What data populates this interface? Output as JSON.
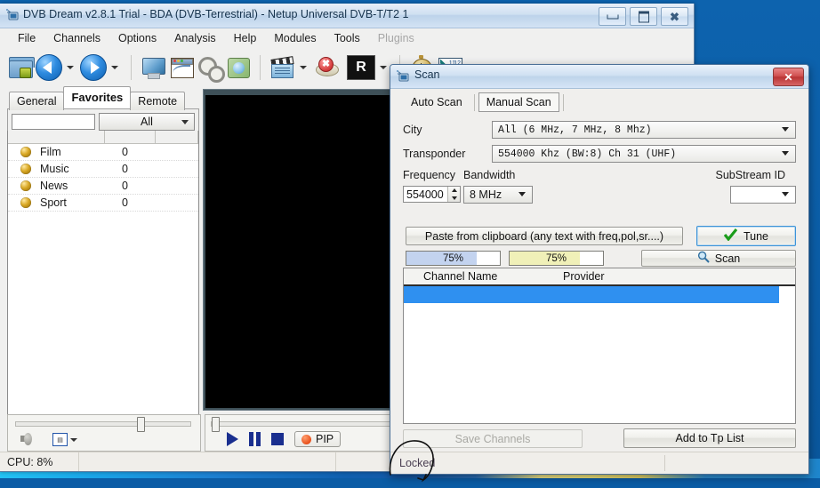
{
  "app": {
    "title": "DVB Dream v2.8.1 Trial - BDA (DVB-Terrestrial)  -  Netup Universal DVB-T/T2 1",
    "window_buttons": {
      "minimize": "minimize-button",
      "maximize": "maximize-button",
      "close": "close-button"
    },
    "menu": [
      {
        "label": "File",
        "disabled": false
      },
      {
        "label": "Channels",
        "disabled": false
      },
      {
        "label": "Options",
        "disabled": false
      },
      {
        "label": "Analysis",
        "disabled": false
      },
      {
        "label": "Help",
        "disabled": false
      },
      {
        "label": "Modules",
        "disabled": false
      },
      {
        "label": "Tools",
        "disabled": false
      },
      {
        "label": "Plugins",
        "disabled": true
      }
    ],
    "toolbar": [
      {
        "icon": "open-folder-icon"
      },
      {
        "icon": "back-arrow-icon",
        "dropdown": true
      },
      {
        "icon": "forward-arrow-icon",
        "dropdown": true
      },
      {
        "icon": "monitor-icon"
      },
      {
        "icon": "window-icon"
      },
      {
        "icon": "gears-icon"
      },
      {
        "icon": "picture-icon"
      },
      {
        "icon": "clapperboard-icon",
        "dropdown": true
      },
      {
        "icon": "no-signal-icon"
      },
      {
        "icon": "record-R-icon",
        "dropdown": true
      },
      {
        "icon": "stopwatch-icon"
      },
      {
        "icon": "signal-chart-icon"
      }
    ]
  },
  "left_panel": {
    "tabs": [
      {
        "label": "General",
        "active": false
      },
      {
        "label": "Favorites",
        "active": true
      },
      {
        "label": "Remote",
        "active": false
      }
    ],
    "search": {
      "value": "",
      "placeholder": ""
    },
    "category_select": {
      "value": "All"
    },
    "list": {
      "rows": [
        {
          "name": "Film",
          "count": "0"
        },
        {
          "name": "Music",
          "count": "0"
        },
        {
          "name": "News",
          "count": "0"
        },
        {
          "name": "Sport",
          "count": "0"
        }
      ]
    }
  },
  "player": {
    "buttons": [
      {
        "label": "play-button"
      },
      {
        "label": "pause-button"
      },
      {
        "label": "stop-button"
      }
    ],
    "pip_label": "PIP"
  },
  "statusbar": {
    "cpu": "CPU: 8%"
  },
  "scan_dialog": {
    "title": "Scan",
    "close_label": "✕",
    "tabs": [
      {
        "label": "Auto Scan",
        "active": false
      },
      {
        "label": "Manual Scan",
        "active": true
      }
    ],
    "fields": {
      "city_label": "City",
      "city_value": "All  (6 MHz,  7 MHz,  8 Mhz)",
      "transponder_label": "Transponder",
      "transponder_value": "554000 Khz  (BW:8)     Ch 31   (UHF)",
      "frequency_label": "Frequency",
      "frequency_value": "554000",
      "bandwidth_label": "Bandwidth",
      "bandwidth_value": "8 MHz",
      "substream_label": "SubStream ID",
      "substream_value": ""
    },
    "buttons": {
      "paste": "Paste from clipboard   (any text with freq,pol,sr....)",
      "tune": "Tune",
      "scan": "Scan",
      "save_channels": "Save Channels",
      "add_to_tp_list": "Add to Tp List"
    },
    "meters": [
      {
        "name": "signal-strength-bar",
        "label": "75%",
        "percent": 75,
        "color": "#c3d3ef"
      },
      {
        "name": "signal-quality-bar",
        "label": "75%",
        "percent": 75,
        "color": "#f0f0b8"
      }
    ],
    "list": {
      "columns": [
        "Channel Name",
        "Provider"
      ],
      "rows": [
        {
          "channel_name": "",
          "provider": "",
          "selected": true
        }
      ]
    },
    "status": {
      "locked": "Locked"
    }
  },
  "annotation": {
    "shape": "hand-drawn-ellipse",
    "target": "Locked"
  },
  "colors": {
    "desktop": "#0b5ca5",
    "selection": "#2f90f0",
    "title_active": "#cfe0f2",
    "close_red": "#c94a4a"
  }
}
